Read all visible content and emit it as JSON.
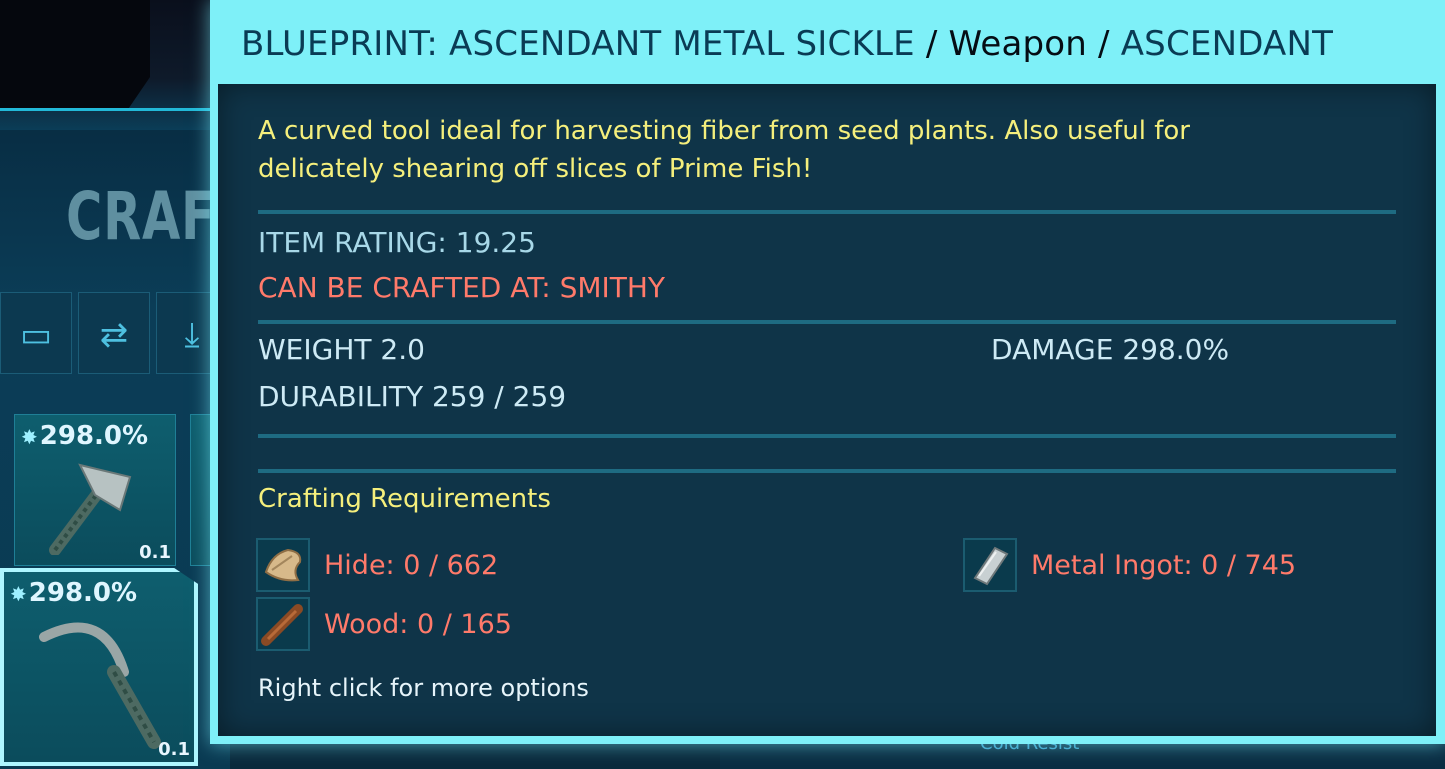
{
  "background": {
    "crafting_tab": "CRAFT",
    "slots": [
      {
        "pct": "298.0%",
        "weight": "0.1",
        "item": "hatchet"
      },
      {
        "pct": "298.0%",
        "weight": "0.1",
        "item": "sickle",
        "selected": true
      }
    ],
    "bottom_text": "Cold Resist"
  },
  "tooltip": {
    "title_name": "BLUEPRINT: ASCENDANT METAL SICKLE",
    "title_sep": "/",
    "title_type": "Weapon",
    "title_quality": "ASCENDANT",
    "description": "A curved tool ideal for harvesting fiber from seed plants. Also useful for delicately shearing off slices of Prime Fish!",
    "item_rating": "ITEM RATING: 19.25",
    "crafted_at": "CAN BE CRAFTED AT: SMITHY",
    "weight": "WEIGHT 2.0",
    "damage": "DAMAGE 298.0%",
    "durability": "DURABILITY 259 / 259",
    "requirements_header": "Crafting Requirements",
    "requirements": [
      {
        "label": "Hide: 0 / 662",
        "icon": "hide-icon"
      },
      {
        "label": "Metal Ingot: 0 / 745",
        "icon": "metal-ingot-icon"
      },
      {
        "label": "Wood: 0 / 165",
        "icon": "wood-icon"
      }
    ],
    "hint": "Right click for more options"
  },
  "colors": {
    "title_bar": "#7ef0f8",
    "panel": "#06263a",
    "description": "#f5ef7c",
    "stat": "#a8d8e8",
    "missing_resource": "#ff7a6a"
  }
}
